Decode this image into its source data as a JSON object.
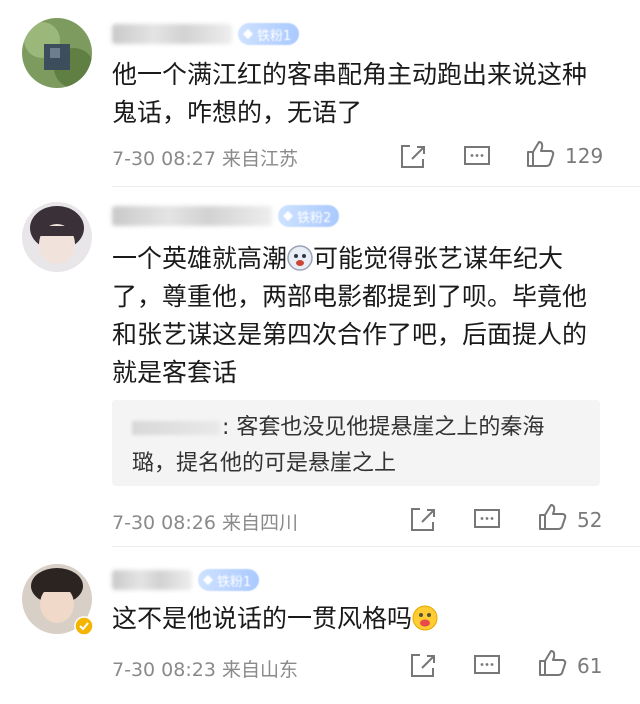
{
  "comments": [
    {
      "badge": "铁粉1",
      "text_line1": "他一个满江红的客串配角主动跑出来说这种",
      "text_line2": "鬼话，咋想的，无语了",
      "time": "7-30 08:27",
      "location": "来自江苏",
      "likes": "129"
    },
    {
      "badge": "铁粉2",
      "text_line1a": "一个英雄就高潮",
      "text_line1b": "可能觉得张艺谋年纪大",
      "text_line2": "了，尊重他，两部电影都提到了呗。毕竟他",
      "text_line3": "和张艺谋这是第四次合作了吧，后面提人的",
      "text_line4": "就是客套话",
      "reply_suffix": ":",
      "reply_line1": "客套也没见他提悬崖之上的秦海",
      "reply_line2": "璐，提名他的可是悬崖之上",
      "time": "7-30 08:26",
      "location": "来自四川",
      "likes": "52"
    },
    {
      "badge": "铁粉1",
      "text": "这不是他说话的一贯风格吗",
      "time": "7-30 08:23",
      "location": "来自山东",
      "likes": "61"
    }
  ],
  "icons": {
    "share": "share-icon",
    "comment": "comment-icon",
    "like": "thumbs-up-icon",
    "badge": "diamond-icon"
  },
  "colors": {
    "text": "#1a1a1a",
    "meta": "#8a8a8a",
    "badge": "#a9c9ff",
    "quote_bg": "#f4f4f4"
  }
}
